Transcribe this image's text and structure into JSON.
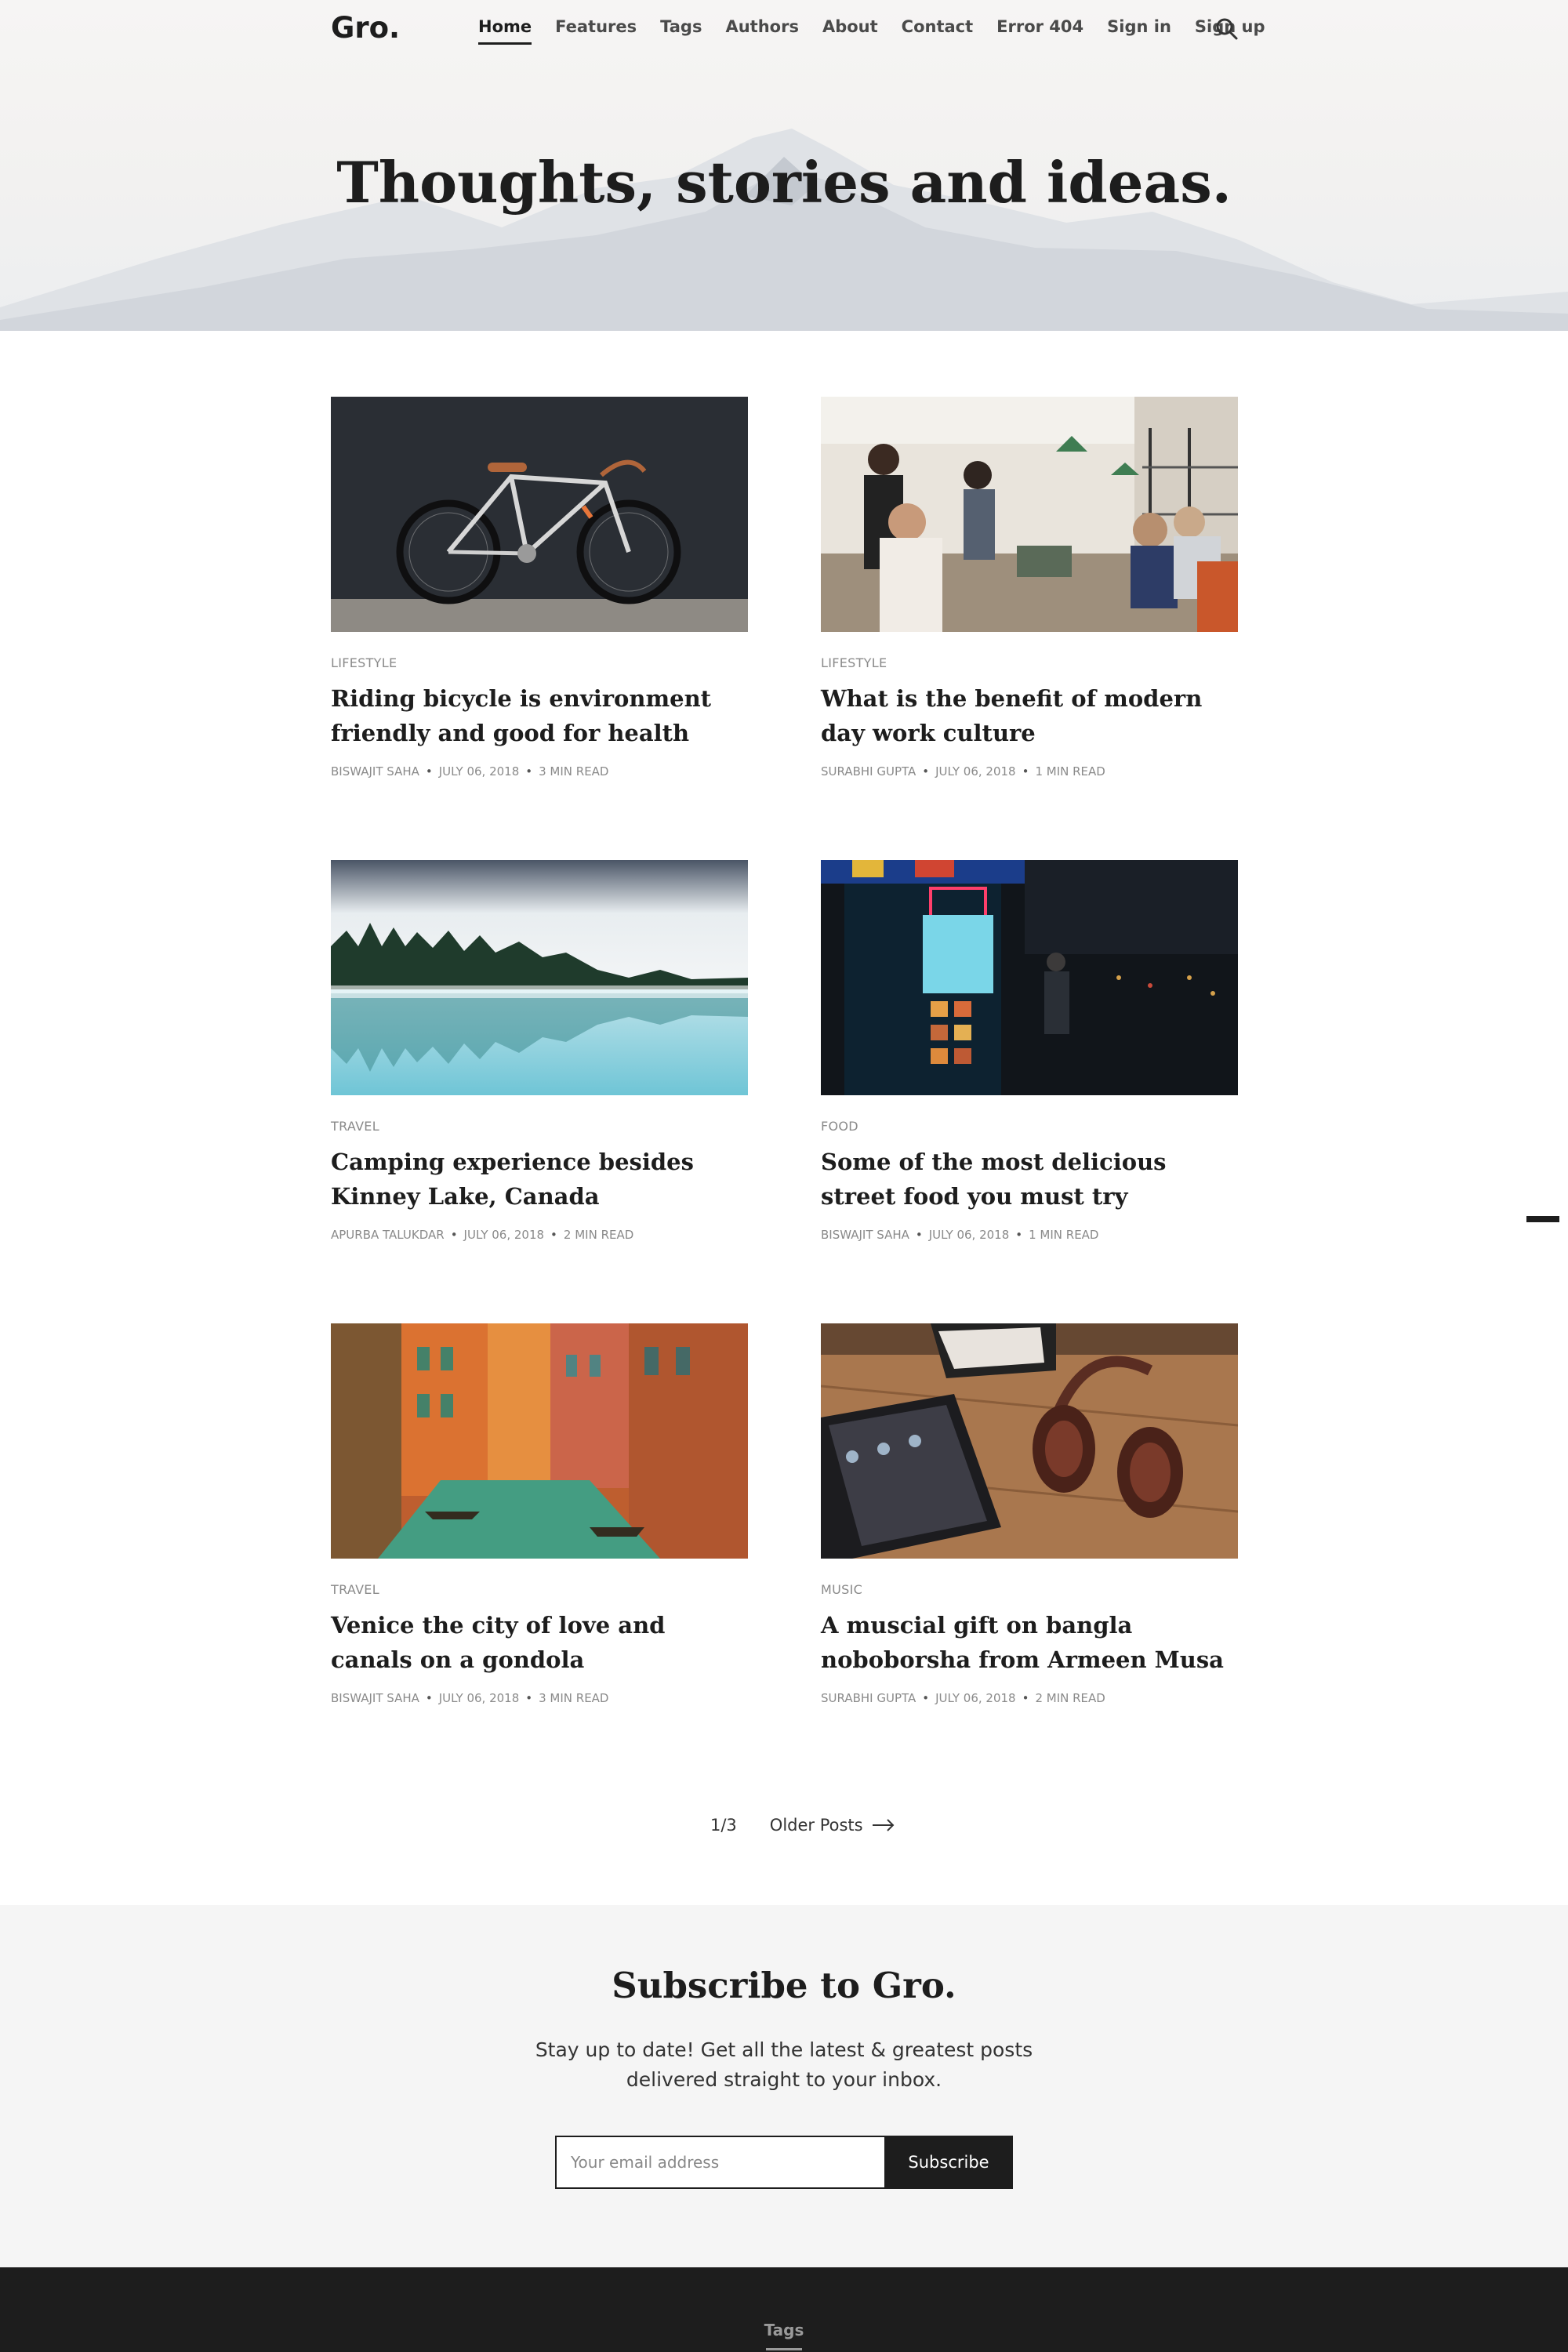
{
  "brand": {
    "logo": "Gro."
  },
  "nav": {
    "items": [
      {
        "label": "Home",
        "active": true
      },
      {
        "label": "Features"
      },
      {
        "label": "Tags"
      },
      {
        "label": "Authors"
      },
      {
        "label": "About"
      },
      {
        "label": "Contact"
      },
      {
        "label": "Error 404"
      },
      {
        "label": "Sign in"
      },
      {
        "label": "Sign up"
      }
    ],
    "search_icon": "search-icon"
  },
  "hero": {
    "title": "Thoughts, stories and ideas."
  },
  "posts": [
    {
      "category": "LIFESTYLE",
      "title": "Riding bicycle is environment friendly and good for health",
      "author": "BISWAJIT SAHA",
      "date": "JULY 06, 2018",
      "read": "3 MIN READ",
      "image": "bicycle-against-dark-wall"
    },
    {
      "category": "LIFESTYLE",
      "title": "What is the benefit of modern day work culture",
      "author": "SURABHI GUPTA",
      "date": "JULY 06, 2018",
      "read": "1 MIN READ",
      "image": "busy-cafe-interior"
    },
    {
      "category": "TRAVEL",
      "title": "Camping experience besides Kinney Lake, Canada",
      "author": "APURBA TALUKDAR",
      "date": "JULY 06, 2018",
      "read": "2 MIN READ",
      "image": "misty-forest-lake"
    },
    {
      "category": "FOOD",
      "title": "Some of the most delicious street food you must try",
      "author": "BISWAJIT SAHA",
      "date": "JULY 06, 2018",
      "read": "1 MIN READ",
      "image": "night-street-food-stall"
    },
    {
      "category": "TRAVEL",
      "title": "Venice the city of love and canals on a gondola",
      "author": "BISWAJIT SAHA",
      "date": "JULY 06, 2018",
      "read": "3 MIN READ",
      "image": "venice-canal"
    },
    {
      "category": "MUSIC",
      "title": "A muscial gift on bangla noboborsha from Armeen Musa",
      "author": "SURABHI GUPTA",
      "date": "JULY 06, 2018",
      "read": "2 MIN READ",
      "image": "headphones-and-tablet"
    }
  ],
  "pagination": {
    "page": "1/3",
    "older_label": "Older Posts"
  },
  "subscribe": {
    "title": "Subscribe to Gro.",
    "text": "Stay up to date! Get all the latest & greatest posts delivered straight to your inbox.",
    "placeholder": "Your email address",
    "button": "Subscribe"
  },
  "footer": {
    "tags_label": "Tags"
  },
  "colors": {
    "text": "#1d1d1d",
    "muted": "#8a8a8a",
    "subscribe_bg": "#f5f5f5",
    "footer_bg": "#1d1d1d"
  }
}
